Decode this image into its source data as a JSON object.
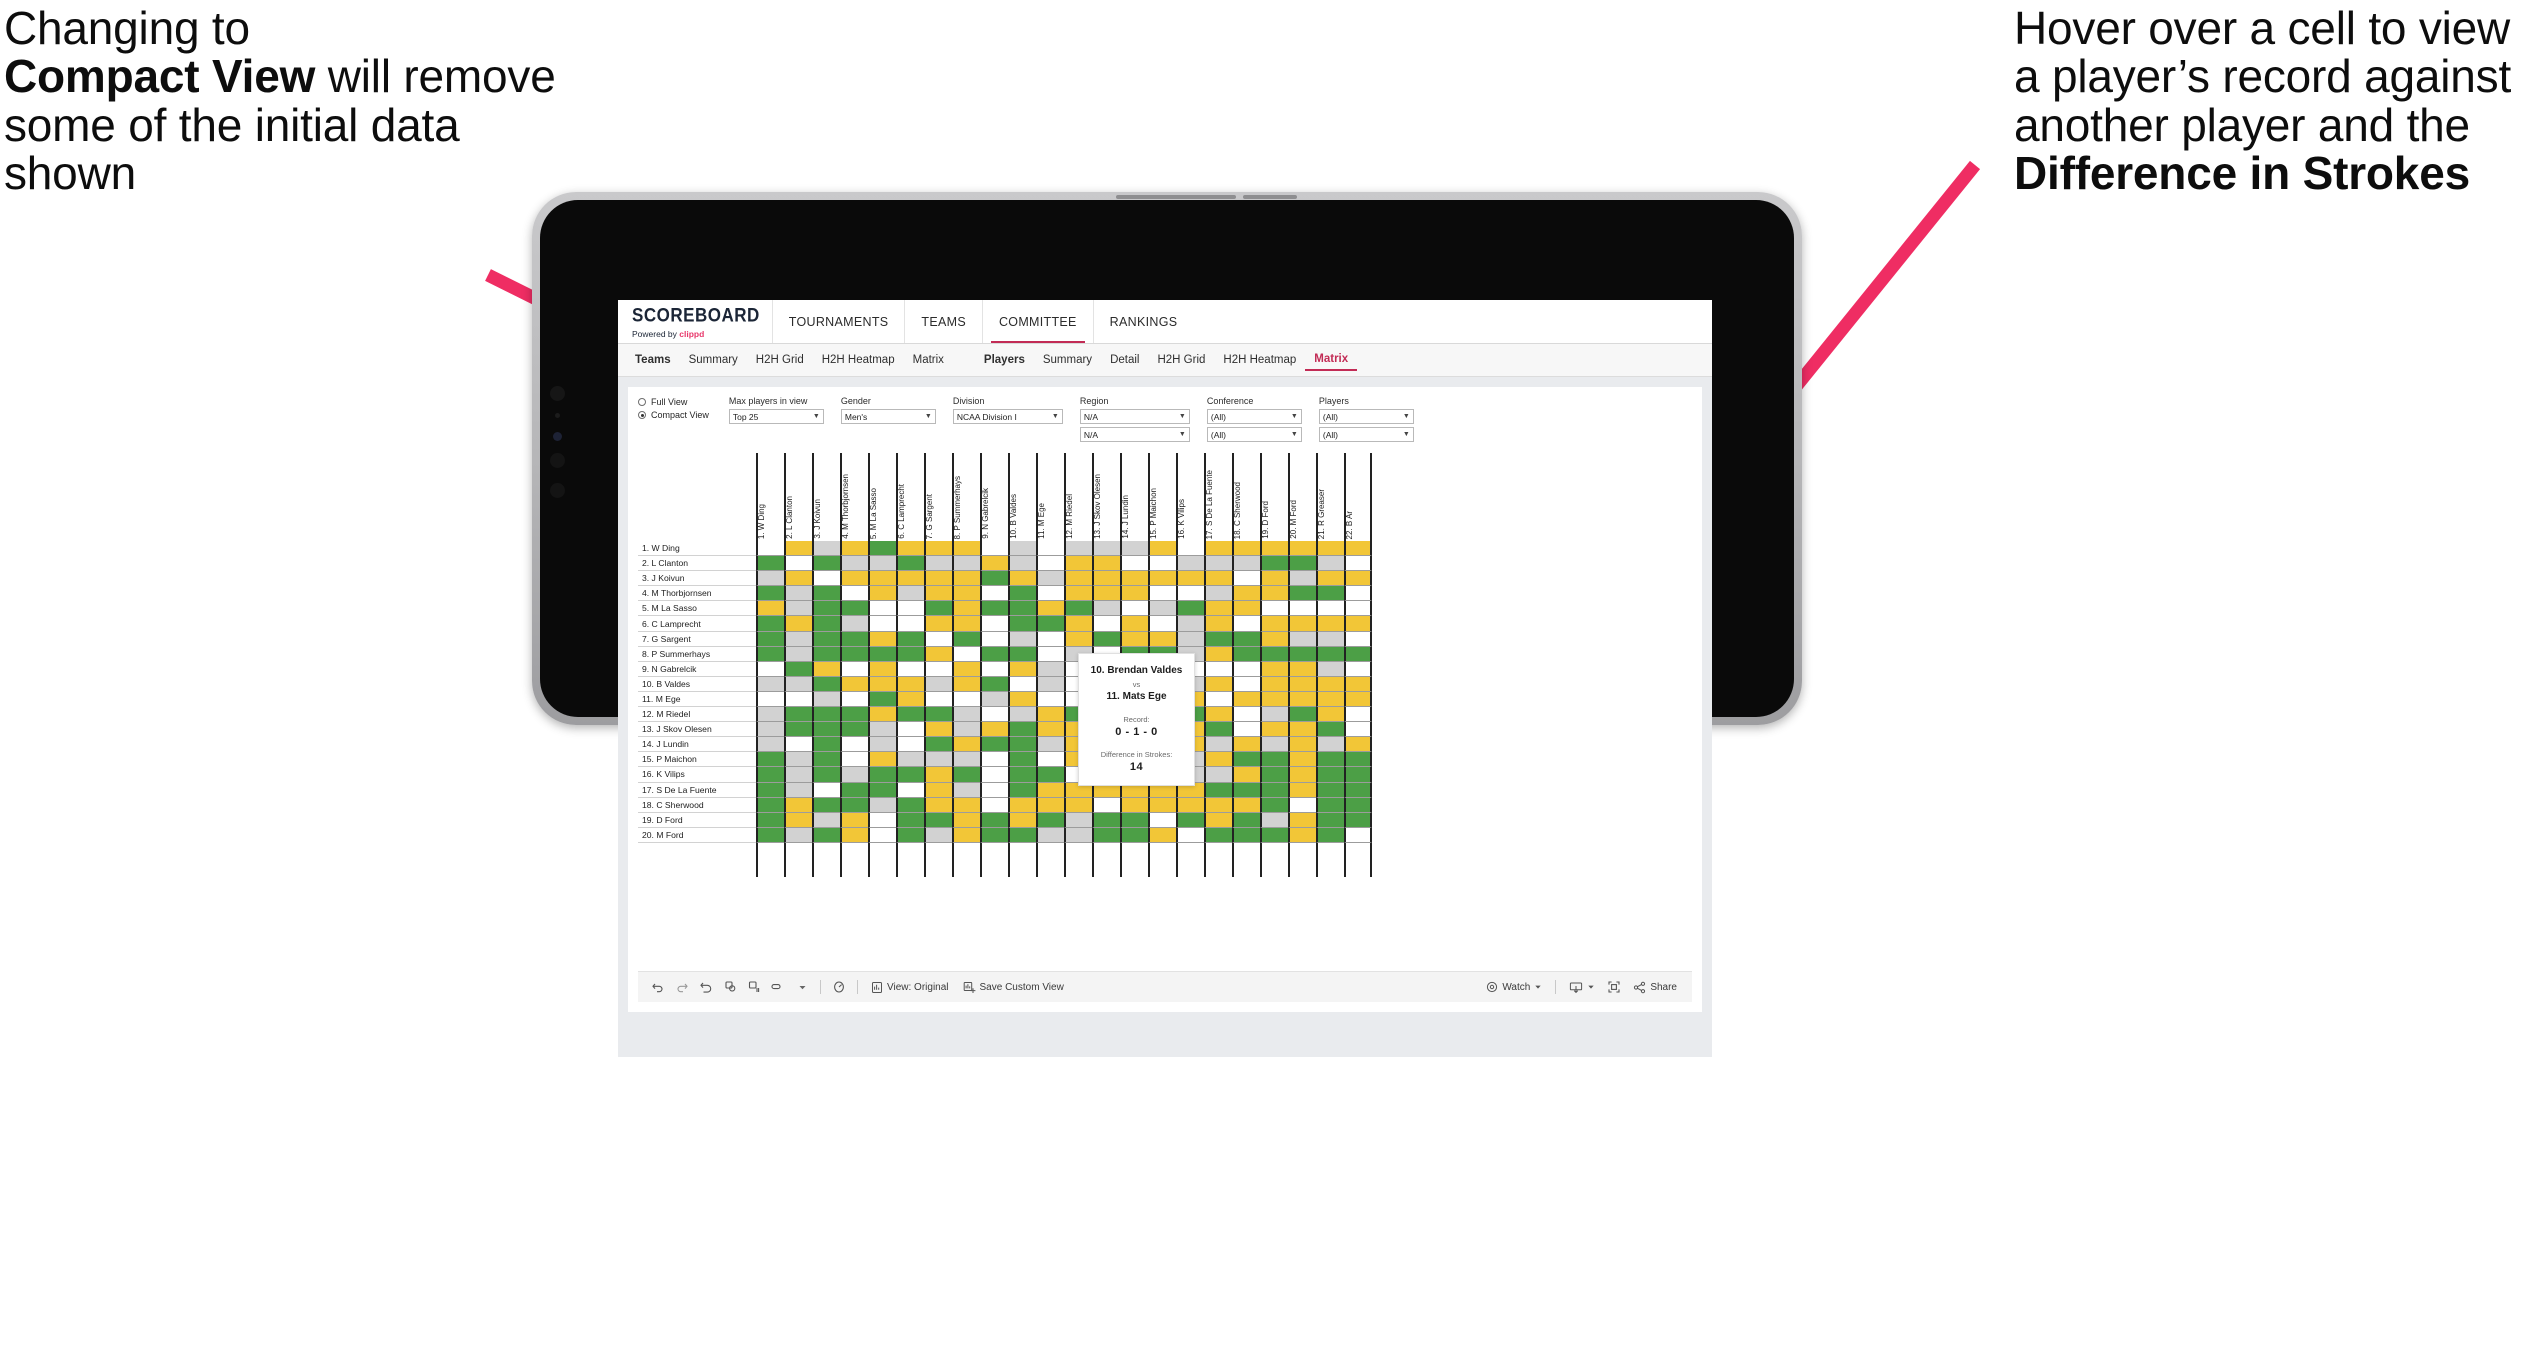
{
  "annotations": {
    "left": {
      "line1": "Changing to",
      "bold": "Compact View",
      "line2": " will remove some of the initial data shown"
    },
    "right": {
      "line1": "Hover over a cell to view a player’s record against another player and the ",
      "bold": "Difference in Strokes"
    },
    "arrow_color": "#ef2d63"
  },
  "app": {
    "brand": {
      "title": "SCOREBOARD",
      "powered_prefix": "Powered by ",
      "powered_name": "clippd"
    },
    "nav": [
      {
        "label": "TOURNAMENTS",
        "active": false
      },
      {
        "label": "TEAMS",
        "active": false
      },
      {
        "label": "COMMITTEE",
        "active": true
      },
      {
        "label": "RANKINGS",
        "active": false
      }
    ],
    "subtabs_teams": [
      {
        "label": "Teams",
        "style": "strong"
      },
      {
        "label": "Summary",
        "style": ""
      },
      {
        "label": "H2H Grid",
        "style": ""
      },
      {
        "label": "H2H Heatmap",
        "style": ""
      },
      {
        "label": "Matrix",
        "style": ""
      }
    ],
    "subtabs_players": [
      {
        "label": "Players",
        "style": "strong"
      },
      {
        "label": "Summary",
        "style": ""
      },
      {
        "label": "Detail",
        "style": ""
      },
      {
        "label": "H2H Grid",
        "style": ""
      },
      {
        "label": "H2H Heatmap",
        "style": ""
      },
      {
        "label": "Matrix",
        "style": "pinked"
      }
    ],
    "view_toggle": [
      {
        "label": "Full View",
        "selected": false
      },
      {
        "label": "Compact View",
        "selected": true
      }
    ],
    "filters": [
      {
        "label": "Max players in view",
        "value": "Top 25",
        "value2": null
      },
      {
        "label": "Gender",
        "value": "Men's",
        "value2": null
      },
      {
        "label": "Division",
        "value": "NCAA Division I",
        "value2": null
      },
      {
        "label": "Region",
        "value": "N/A",
        "value2": "N/A"
      },
      {
        "label": "Conference",
        "value": "(All)",
        "value2": "(All)"
      },
      {
        "label": "Players",
        "value": "(All)",
        "value2": "(All)"
      }
    ],
    "toolbar": {
      "icons": [
        "undo-icon",
        "redo-icon",
        "revert-icon",
        "refresh-icon",
        "pause-icon",
        "fit-icon",
        "caret-down-icon",
        "clear-sheet-icon"
      ],
      "view_original": "View: Original",
      "save_custom_view": "Save Custom View",
      "watch": "Watch",
      "share": "Share"
    },
    "tooltip": {
      "player_a": "10. Brendan Valdes",
      "vs": "vs",
      "player_b": "11. Mats Ege",
      "record_label": "Record:",
      "record_value": "0 - 1 - 0",
      "diff_label": "Difference in Strokes:",
      "diff_value": "14"
    }
  },
  "chart_data": {
    "type": "heatmap",
    "title": "Player Head-to-Head Matrix",
    "legend": {
      "green": "#4c9f46",
      "yellow": "#f2c637",
      "grey": "#d2d2d2",
      "white": "#ffffff"
    },
    "row_labels": [
      "1. W Ding",
      "2. L Clanton",
      "3. J Koivun",
      "4. M Thorbjornsen",
      "5. M La Sasso",
      "6. C Lamprecht",
      "7. G Sargent",
      "8. P Summerhays",
      "9. N Gabrelcik",
      "10. B Valdes",
      "11. M Ege",
      "12. M Riedel",
      "13. J Skov Olesen",
      "14. J Lundin",
      "15. P Maichon",
      "16. K Vilips",
      "17. S De La Fuente",
      "18. C Sherwood",
      "19. D Ford",
      "20. M Ford"
    ],
    "col_labels": [
      "1. W Ding",
      "2. L Clanton",
      "3. J Koivun",
      "4. M Thorbjornsen",
      "5. M La Sasso",
      "6. C Lamprecht",
      "7. G Sargent",
      "8. P Summerhays",
      "9. N Gabrelcik",
      "10. B Valdes",
      "11. M Ege",
      "12. M Riedel",
      "13. J Skov Olesen",
      "14. J Lundin",
      "15. P Maichon",
      "16. K Vilips",
      "17. S De La Fuente",
      "18. C Sherwood",
      "19. D Ford",
      "20. M Ford",
      "21. R Greaser",
      "22. B Ar"
    ],
    "cells": [
      [
        "w",
        "y",
        "s",
        "y",
        "g",
        "y",
        "y",
        "y",
        "w",
        "s",
        "w",
        "s",
        "s",
        "s",
        "y",
        "w",
        "y",
        "y",
        "y",
        "y",
        "y",
        "y"
      ],
      [
        "g",
        "w",
        "g",
        "s",
        "s",
        "g",
        "s",
        "s",
        "y",
        "s",
        "w",
        "y",
        "y",
        "w",
        "w",
        "s",
        "s",
        "s",
        "g",
        "g",
        "s",
        "w"
      ],
      [
        "s",
        "y",
        "w",
        "y",
        "y",
        "y",
        "y",
        "y",
        "g",
        "y",
        "s",
        "y",
        "y",
        "y",
        "y",
        "y",
        "y",
        "w",
        "y",
        "s",
        "y",
        "y"
      ],
      [
        "g",
        "s",
        "g",
        "w",
        "y",
        "s",
        "y",
        "y",
        "w",
        "g",
        "w",
        "y",
        "y",
        "y",
        "w",
        "w",
        "s",
        "y",
        "y",
        "g",
        "g",
        "w"
      ],
      [
        "y",
        "s",
        "g",
        "g",
        "w",
        "w",
        "g",
        "y",
        "g",
        "g",
        "y",
        "g",
        "s",
        "w",
        "s",
        "g",
        "y",
        "y",
        "w",
        "w",
        "w",
        "w"
      ],
      [
        "g",
        "y",
        "g",
        "s",
        "w",
        "w",
        "y",
        "y",
        "w",
        "g",
        "g",
        "y",
        "w",
        "y",
        "w",
        "s",
        "y",
        "w",
        "y",
        "y",
        "y",
        "y"
      ],
      [
        "g",
        "s",
        "g",
        "g",
        "y",
        "g",
        "w",
        "g",
        "w",
        "s",
        "w",
        "y",
        "g",
        "y",
        "y",
        "s",
        "g",
        "g",
        "y",
        "s",
        "s",
        "w"
      ],
      [
        "g",
        "s",
        "g",
        "g",
        "g",
        "g",
        "y",
        "w",
        "g",
        "g",
        "w",
        "s",
        "w",
        "g",
        "g",
        "s",
        "y",
        "g",
        "g",
        "g",
        "g",
        "g"
      ],
      [
        "w",
        "g",
        "y",
        "w",
        "y",
        "w",
        "w",
        "y",
        "w",
        "y",
        "s",
        "w",
        "g",
        "y",
        "y",
        "w",
        "w",
        "w",
        "y",
        "y",
        "s",
        "w"
      ],
      [
        "s",
        "s",
        "g",
        "y",
        "y",
        "y",
        "s",
        "y",
        "g",
        "w",
        "s",
        "w",
        "s",
        "y",
        "y",
        "s",
        "y",
        "w",
        "y",
        "y",
        "y",
        "y"
      ],
      [
        "w",
        "w",
        "s",
        "w",
        "g",
        "y",
        "w",
        "w",
        "s",
        "y",
        "w",
        "w",
        "w",
        "w",
        "g",
        "y",
        "w",
        "y",
        "y",
        "y",
        "y",
        "y"
      ],
      [
        "s",
        "g",
        "g",
        "g",
        "y",
        "g",
        "g",
        "s",
        "w",
        "s",
        "y",
        "g",
        "s",
        "s",
        "s",
        "g",
        "y",
        "w",
        "s",
        "g",
        "y",
        "w"
      ],
      [
        "s",
        "g",
        "g",
        "g",
        "s",
        "w",
        "y",
        "s",
        "y",
        "g",
        "y",
        "y",
        "y",
        "y",
        "y",
        "y",
        "g",
        "w",
        "y",
        "y",
        "g",
        "w"
      ],
      [
        "s",
        "w",
        "g",
        "w",
        "s",
        "w",
        "g",
        "y",
        "g",
        "g",
        "s",
        "y",
        "y",
        "g",
        "s",
        "y",
        "s",
        "y",
        "s",
        "y",
        "s",
        "y"
      ],
      [
        "g",
        "s",
        "g",
        "w",
        "y",
        "s",
        "s",
        "s",
        "w",
        "g",
        "w",
        "y",
        "g",
        "g",
        "y",
        "s",
        "y",
        "g",
        "g",
        "y",
        "g",
        "g"
      ],
      [
        "g",
        "s",
        "g",
        "s",
        "g",
        "g",
        "y",
        "g",
        "w",
        "g",
        "g",
        "w",
        "y",
        "w",
        "g",
        "s",
        "s",
        "y",
        "g",
        "y",
        "g",
        "g"
      ],
      [
        "g",
        "s",
        "w",
        "g",
        "g",
        "w",
        "y",
        "s",
        "w",
        "g",
        "y",
        "y",
        "y",
        "y",
        "y",
        "y",
        "g",
        "g",
        "g",
        "y",
        "g",
        "g"
      ],
      [
        "g",
        "y",
        "g",
        "g",
        "s",
        "g",
        "y",
        "y",
        "w",
        "y",
        "y",
        "y",
        "w",
        "y",
        "y",
        "y",
        "y",
        "y",
        "g",
        "w",
        "g",
        "g"
      ],
      [
        "g",
        "y",
        "s",
        "y",
        "w",
        "g",
        "g",
        "y",
        "g",
        "y",
        "g",
        "s",
        "g",
        "g",
        "w",
        "g",
        "y",
        "g",
        "s",
        "y",
        "g",
        "g"
      ],
      [
        "g",
        "s",
        "g",
        "y",
        "w",
        "g",
        "s",
        "y",
        "g",
        "g",
        "s",
        "s",
        "g",
        "g",
        "y",
        "w",
        "g",
        "g",
        "g",
        "y",
        "g",
        "w"
      ]
    ]
  }
}
